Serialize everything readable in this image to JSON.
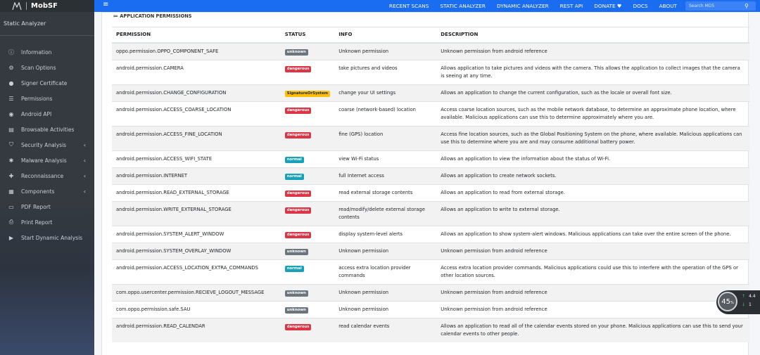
{
  "brand": {
    "name": "MobSF"
  },
  "nav": {
    "links": [
      "RECENT SCANS",
      "STATIC ANALYZER",
      "DYNAMIC ANALYZER",
      "REST API",
      "DONATE ♥",
      "DOCS",
      "ABOUT"
    ],
    "search_placeholder": "Search MD5"
  },
  "sidebar": {
    "header": "Static Analyzer",
    "items": [
      {
        "label": "Information",
        "icon": "info-circle-icon",
        "chevron": false
      },
      {
        "label": "Scan Options",
        "icon": "gear-icon",
        "chevron": false
      },
      {
        "label": "Signer Certificate",
        "icon": "certificate-icon",
        "chevron": false
      },
      {
        "label": "Permissions",
        "icon": "list-icon",
        "chevron": false
      },
      {
        "label": "Android API",
        "icon": "android-icon",
        "chevron": false
      },
      {
        "label": "Browsable Activities",
        "icon": "clone-icon",
        "chevron": false
      },
      {
        "label": "Security Analysis",
        "icon": "shield-icon",
        "chevron": true
      },
      {
        "label": "Malware Analysis",
        "icon": "bug-icon",
        "chevron": true
      },
      {
        "label": "Reconnaissance",
        "icon": "crosshair-icon",
        "chevron": true
      },
      {
        "label": "Components",
        "icon": "grid-icon",
        "chevron": true
      },
      {
        "label": "PDF Report",
        "icon": "file-pdf-icon",
        "chevron": false
      },
      {
        "label": "Print Report",
        "icon": "print-icon",
        "chevron": false
      },
      {
        "label": "Start Dynamic Analysis",
        "icon": "play-circle-icon",
        "chevron": false
      }
    ]
  },
  "section_title": "≔ APPLICATION PERMISSIONS",
  "table": {
    "headers": [
      "PERMISSION",
      "STATUS",
      "INFO",
      "DESCRIPTION"
    ],
    "status_colors": {
      "unknown": "#6c757d",
      "dangerous": "#dc3545",
      "SignatureOrSystem": "#ffc107",
      "normal": "#17a2b8"
    },
    "rows": [
      {
        "permission": "oppo.permission.OPPO_COMPONENT_SAFE",
        "status": "unknown",
        "info": "Unknown permission",
        "description": "Unknown permission from android reference"
      },
      {
        "permission": "android.permission.CAMERA",
        "status": "dangerous",
        "info": "take pictures and videos",
        "description": "Allows application to take pictures and videos with the camera. This allows the application to collect images that the camera is seeing at any time."
      },
      {
        "permission": "android.permission.CHANGE_CONFIGURATION",
        "status": "SignatureOrSystem",
        "info": "change your UI settings",
        "description": "Allows an application to change the current configuration, such as the locale or overall font size."
      },
      {
        "permission": "android.permission.ACCESS_COARSE_LOCATION",
        "status": "dangerous",
        "info": "coarse (network-based) location",
        "description": "Access coarse location sources, such as the mobile network database, to determine an approximate phone location, where available. Malicious applications can use this to determine approximately where you are."
      },
      {
        "permission": "android.permission.ACCESS_FINE_LOCATION",
        "status": "dangerous",
        "info": "fine (GPS) location",
        "description": "Access fine location sources, such as the Global Positioning System on the phone, where available. Malicious applications can use this to determine where you are and may consume additional battery power."
      },
      {
        "permission": "android.permission.ACCESS_WIFI_STATE",
        "status": "normal",
        "info": "view Wi-Fi status",
        "description": "Allows an application to view the information about the status of Wi-Fi."
      },
      {
        "permission": "android.permission.INTERNET",
        "status": "normal",
        "info": "full Internet access",
        "description": "Allows an application to create network sockets."
      },
      {
        "permission": "android.permission.READ_EXTERNAL_STORAGE",
        "status": "dangerous",
        "info": "read external storage contents",
        "description": "Allows an application to read from external storage."
      },
      {
        "permission": "android.permission.WRITE_EXTERNAL_STORAGE",
        "status": "dangerous",
        "info": "read/modify/delete external storage contents",
        "description": "Allows an application to write to external storage."
      },
      {
        "permission": "android.permission.SYSTEM_ALERT_WINDOW",
        "status": "dangerous",
        "info": "display system-level alerts",
        "description": "Allows an application to show system-alert windows. Malicious applications can take over the entire screen of the phone."
      },
      {
        "permission": "android.permission.SYSTEM_OVERLAY_WINDOW",
        "status": "unknown",
        "info": "Unknown permission",
        "description": "Unknown permission from android reference"
      },
      {
        "permission": "android.permission.ACCESS_LOCATION_EXTRA_COMMANDS",
        "status": "normal",
        "info": "access extra location provider commands",
        "description": "Access extra location provider commands. Malicious applications could use this to interfere with the operation of the GPS or other location sources."
      },
      {
        "permission": "com.oppo.usercenter.permission.RECIEVE_LOGOUT_MESSAGE",
        "status": "unknown",
        "info": "Unknown permission",
        "description": "Unknown permission from android reference"
      },
      {
        "permission": "com.oppo.permission.safe.SAU",
        "status": "unknown",
        "info": "Unknown permission",
        "description": "Unknown permission from android reference"
      },
      {
        "permission": "android.permission.READ_CALENDAR",
        "status": "dangerous",
        "info": "read calendar events",
        "description": "Allows an application to read all of the calendar events stored on your phone. Malicious applications can use this to send your calendar events to other people."
      }
    ]
  },
  "widget": {
    "percent": "45",
    "unit": "%",
    "up": "4.4",
    "down": "1"
  }
}
